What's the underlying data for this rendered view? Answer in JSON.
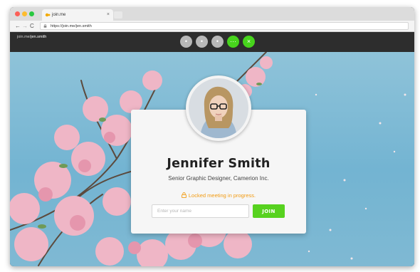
{
  "browser": {
    "tab_title": "join.me",
    "tab_close_glyph": "×",
    "address": "https://join.me/jen.smith",
    "nav": {
      "back_glyph": "←",
      "forward_glyph": "→",
      "reload_glyph": "C"
    }
  },
  "app": {
    "path_prefix": "join.me/",
    "path_user": "jen.smith",
    "controls": [
      {
        "icon": "circle-control-icon",
        "glyph": "•"
      },
      {
        "icon": "circle-control-icon",
        "glyph": "•"
      },
      {
        "icon": "circle-control-icon",
        "glyph": "•"
      },
      {
        "icon": "more-icon",
        "glyph": "···"
      },
      {
        "icon": "close-icon",
        "glyph": "×"
      }
    ],
    "colors": {
      "accent": "#57d21f",
      "warning": "#f29b12",
      "header": "#2d2d2d"
    }
  },
  "card": {
    "name": "Jennifer Smith",
    "subtitle": "Senior Graphic Designer, Camerion Inc.",
    "locked_text": "Locked meeting in progress.",
    "input_placeholder": "Enter your name",
    "input_value": "",
    "join_label": "JOIN"
  }
}
